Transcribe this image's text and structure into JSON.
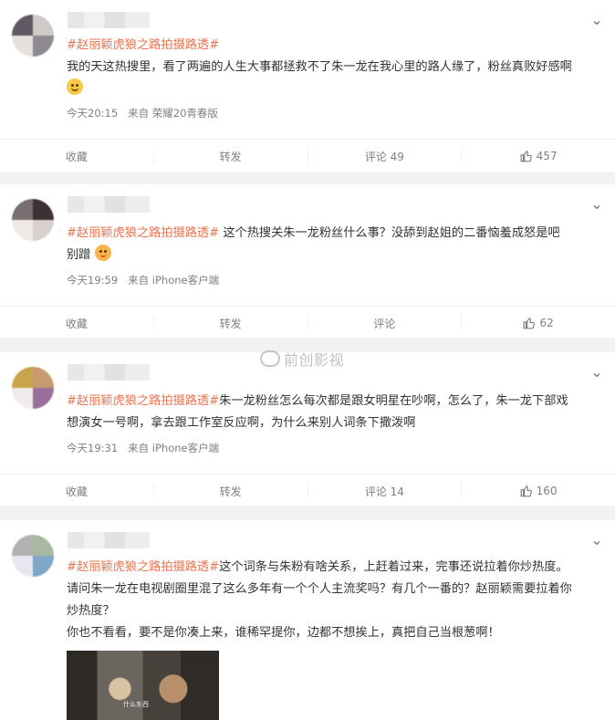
{
  "watermark": "前创影视",
  "posts": [
    {
      "hashtag": "#赵丽颖虎狼之路拍摄路透#",
      "text": "我的天这热搜里，看了两遍的人生大事都拯救不了朱一龙在我心里的路人缘了，粉丝真败好感啊",
      "emoji": "smile-emoji",
      "time": "今天20:15",
      "source": "来自 荣耀20青春版",
      "actions": {
        "fav": "收藏",
        "share": "转发",
        "comment": "评论 49",
        "like": "457"
      }
    },
    {
      "hashtag": "#赵丽颖虎狼之路拍摄路透#",
      "text": " 这个热搜关朱一龙粉丝什么事？没舔到赵姐的二番恼羞成怒是吧",
      "text2": "别蹭",
      "emoji": "shy-emoji",
      "time": "今天19:59",
      "source": "来自 iPhone客户端",
      "actions": {
        "fav": "收藏",
        "share": "转发",
        "comment": "评论",
        "like": "62"
      }
    },
    {
      "hashtag": "#赵丽颖虎狼之路拍摄路透#",
      "text": "朱一龙粉丝怎么每次都是跟女明星在吵啊，怎么了，朱一龙下部戏",
      "text2": "想演女一号啊，拿去跟工作室反应啊，为什么来别人词条下撒泼啊",
      "time": "今天19:31",
      "source": "来自 iPhone客户端",
      "actions": {
        "fav": "收藏",
        "share": "转发",
        "comment": "评论 14",
        "like": "160"
      }
    },
    {
      "hashtag": "#赵丽颖虎狼之路拍摄路透#",
      "text": "这个词条与朱粉有啥关系，上赶着过来，完事还说拉着你炒热度。",
      "text2": "请问朱一龙在电视剧圈里混了这么多年有一个个人主流奖吗？有几个一番的？赵丽颖需要拉着你",
      "text3": "炒热度？",
      "text4": "你也不看看，要不是你凑上来，谁稀罕提你，边都不想挨上，真把自己当根葱啊！",
      "image_caption": "什么东西"
    }
  ]
}
